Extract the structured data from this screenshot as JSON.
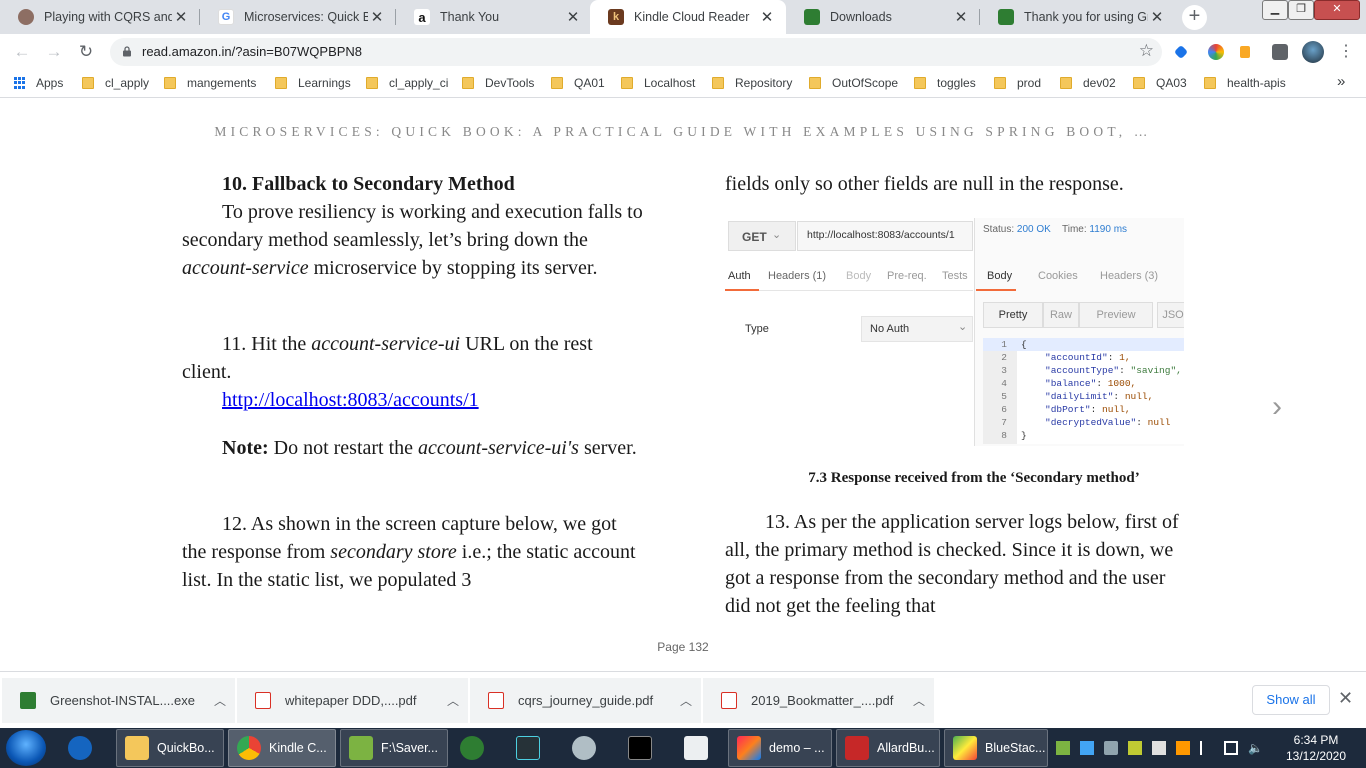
{
  "browser": {
    "tabs": [
      {
        "title": "Playing with CQRS and E",
        "favicon": "avatar-icon"
      },
      {
        "title": "Microservices: Quick Boo",
        "favicon": "google-icon"
      },
      {
        "title": "Thank You",
        "favicon": "amazon-icon"
      },
      {
        "title": "Kindle Cloud Reader",
        "favicon": "kindle-icon",
        "active": true
      },
      {
        "title": "Downloads",
        "favicon": "downloads-icon"
      },
      {
        "title": "Thank you for using Gre",
        "favicon": "greenshot-icon"
      }
    ],
    "new_tab": "+",
    "url": "read.amazon.in/?asin=B07WQPBPN8",
    "bookmarks": [
      "Apps",
      "cl_apply",
      "mangements",
      "Learnings",
      "cl_apply_ci",
      "DevTools",
      "QA01",
      "Localhost",
      "Repository",
      "OutOfScope",
      "toggles",
      "prod",
      "dev02",
      "QA03",
      "health-apis"
    ],
    "bookmarks_overflow": "»"
  },
  "book": {
    "title": "MICROSERVICES: QUICK BOOK: A PRACTICAL GUIDE WITH EXAMPLES USING SPRING BOOT, …",
    "left": {
      "heading": "10. Fallback to Secondary Method",
      "p1_a": "To prove resiliency is working and execution falls to secondary method seamlessly, let’s bring down the ",
      "p1_em": "account-service",
      "p1_b": " microservice by stopping its server.",
      "p2_a": "11. Hit the ",
      "p2_em": "account-service-ui",
      "p2_b": " URL on the rest client.",
      "link": "http://localhost:8083/accounts/1",
      "note_label": "Note:",
      "note_a": " Do not restart the ",
      "note_em": "account-service-ui's",
      "note_b": " server.",
      "p3_a": "12. As shown in the screen capture below, we got the response from ",
      "p3_em": "secondary store",
      "p3_b": " i.e.; the static account list. In the static list, we populated 3"
    },
    "right": {
      "p0": "fields only so other fields are null in the response.",
      "caption": "7.3 Response received from the ‘Secondary method’",
      "p4": "13. As per the application server logs below, first of all, the primary method is checked. Since it is down, we got a response from the secondary method and the user did not get the feeling that"
    },
    "page_label": "Page 132",
    "next_page": "›"
  },
  "figure": {
    "method": "GET",
    "request_url": "http://localhost:8083/accounts/1",
    "status_label": "Status:",
    "status_value": "200 OK",
    "time_label": "Time:",
    "time_value": "1190 ms",
    "req_tabs": [
      "Auth",
      "Headers (1)",
      "Body",
      "Pre-req.",
      "Tests"
    ],
    "resp_tabs": [
      "Body",
      "Cookies",
      "Headers (3)"
    ],
    "view_buttons": [
      "Pretty",
      "Raw",
      "Preview",
      "JSON"
    ],
    "type_label": "Type",
    "auth_value": "No Auth",
    "code_lines": [
      {
        "n": "1",
        "text": "{"
      },
      {
        "n": "2",
        "key": "\"accountId\"",
        "val": "1,",
        "vt": "n"
      },
      {
        "n": "3",
        "key": "\"accountType\"",
        "val": "\"saving\",",
        "vt": "s"
      },
      {
        "n": "4",
        "key": "\"balance\"",
        "val": "1000,",
        "vt": "n"
      },
      {
        "n": "5",
        "key": "\"dailyLimit\"",
        "val": "null,",
        "vt": "n"
      },
      {
        "n": "6",
        "key": "\"dbPort\"",
        "val": "null,",
        "vt": "n"
      },
      {
        "n": "7",
        "key": "\"decryptedValue\"",
        "val": "null",
        "vt": "n"
      },
      {
        "n": "8",
        "text": "}"
      }
    ]
  },
  "downloads": {
    "items": [
      "Greenshot-INSTAL....exe",
      "whitepaper DDD,....pdf",
      "cqrs_journey_guide.pdf",
      "2019_Bookmatter_....pdf"
    ],
    "show_all": "Show all",
    "close": "✕"
  },
  "taskbar": {
    "items": [
      "QuickBo...",
      "Kindle C...",
      "F:\\Saver...",
      "demo – ...",
      "AllardBu...",
      "BlueStac..."
    ],
    "time": "6:34 PM",
    "date": "13/12/2020"
  }
}
